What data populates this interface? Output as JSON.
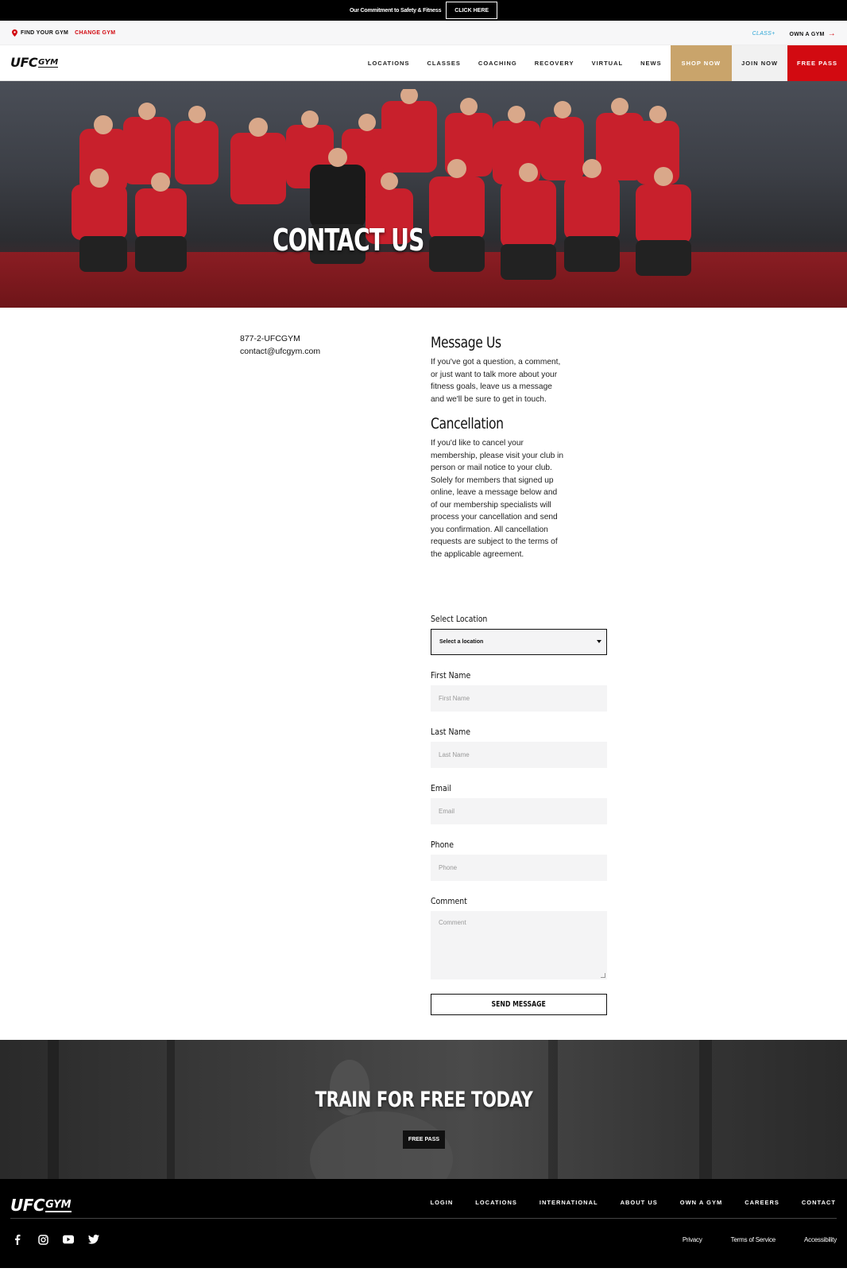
{
  "topbar": {
    "text": "Our Commitment to Safety & Fitness",
    "button": "CLICK HERE"
  },
  "utility": {
    "find": "FIND YOUR GYM",
    "change": "CHANGE GYM",
    "class": "CLASS+",
    "own": "OWN A GYM",
    "arrow": "→"
  },
  "logo": {
    "ufc": "UFC",
    "gym": "GYM"
  },
  "nav": {
    "items": [
      "LOCATIONS",
      "CLASSES",
      "COACHING",
      "RECOVERY",
      "VIRTUAL",
      "NEWS"
    ],
    "shop": "SHOP NOW",
    "join": "JOIN NOW",
    "free": "FREE PASS"
  },
  "hero": {
    "title": "CONTACT US"
  },
  "contact": {
    "phone": "877-2-UFCGYM",
    "email": "contact@ufcgym.com"
  },
  "message": {
    "title": "Message Us",
    "body": "If you've got a question, a comment, or just want to talk more about your fitness goals, leave us a message and we'll be sure to get in touch."
  },
  "cancellation": {
    "title": "Cancellation",
    "body": "If you'd like to cancel your membership, please visit your club in person or mail notice to your club. Solely for members that signed up online, leave a message below and of our membership specialists will process your cancellation and send you confirmation. All cancellation requests are subject to the terms of the applicable agreement."
  },
  "form": {
    "location_label": "Select Location",
    "location_value": "Select a location",
    "first_label": "First Name",
    "first_placeholder": "First Name",
    "last_label": "Last Name",
    "last_placeholder": "Last Name",
    "email_label": "Email",
    "email_placeholder": "Email",
    "phone_label": "Phone",
    "phone_placeholder": "Phone",
    "comment_label": "Comment",
    "comment_placeholder": "Comment",
    "send": "SEND MESSAGE"
  },
  "train": {
    "title": "TRAIN FOR FREE TODAY",
    "button": "FREE PASS"
  },
  "footer": {
    "links": [
      "LOGIN",
      "LOCATIONS",
      "INTERNATIONAL",
      "ABOUT US",
      "OWN A GYM",
      "CAREERS",
      "CONTACT"
    ],
    "social": [
      "facebook-icon",
      "instagram-icon",
      "youtube-icon",
      "twitter-icon"
    ],
    "legal": [
      "Privacy",
      "Terms of Service",
      "Accessibility"
    ]
  },
  "colors": {
    "accent_red": "#d20a11",
    "shop_gold": "#c9a46b",
    "class_blue": "#2ea6d6"
  }
}
